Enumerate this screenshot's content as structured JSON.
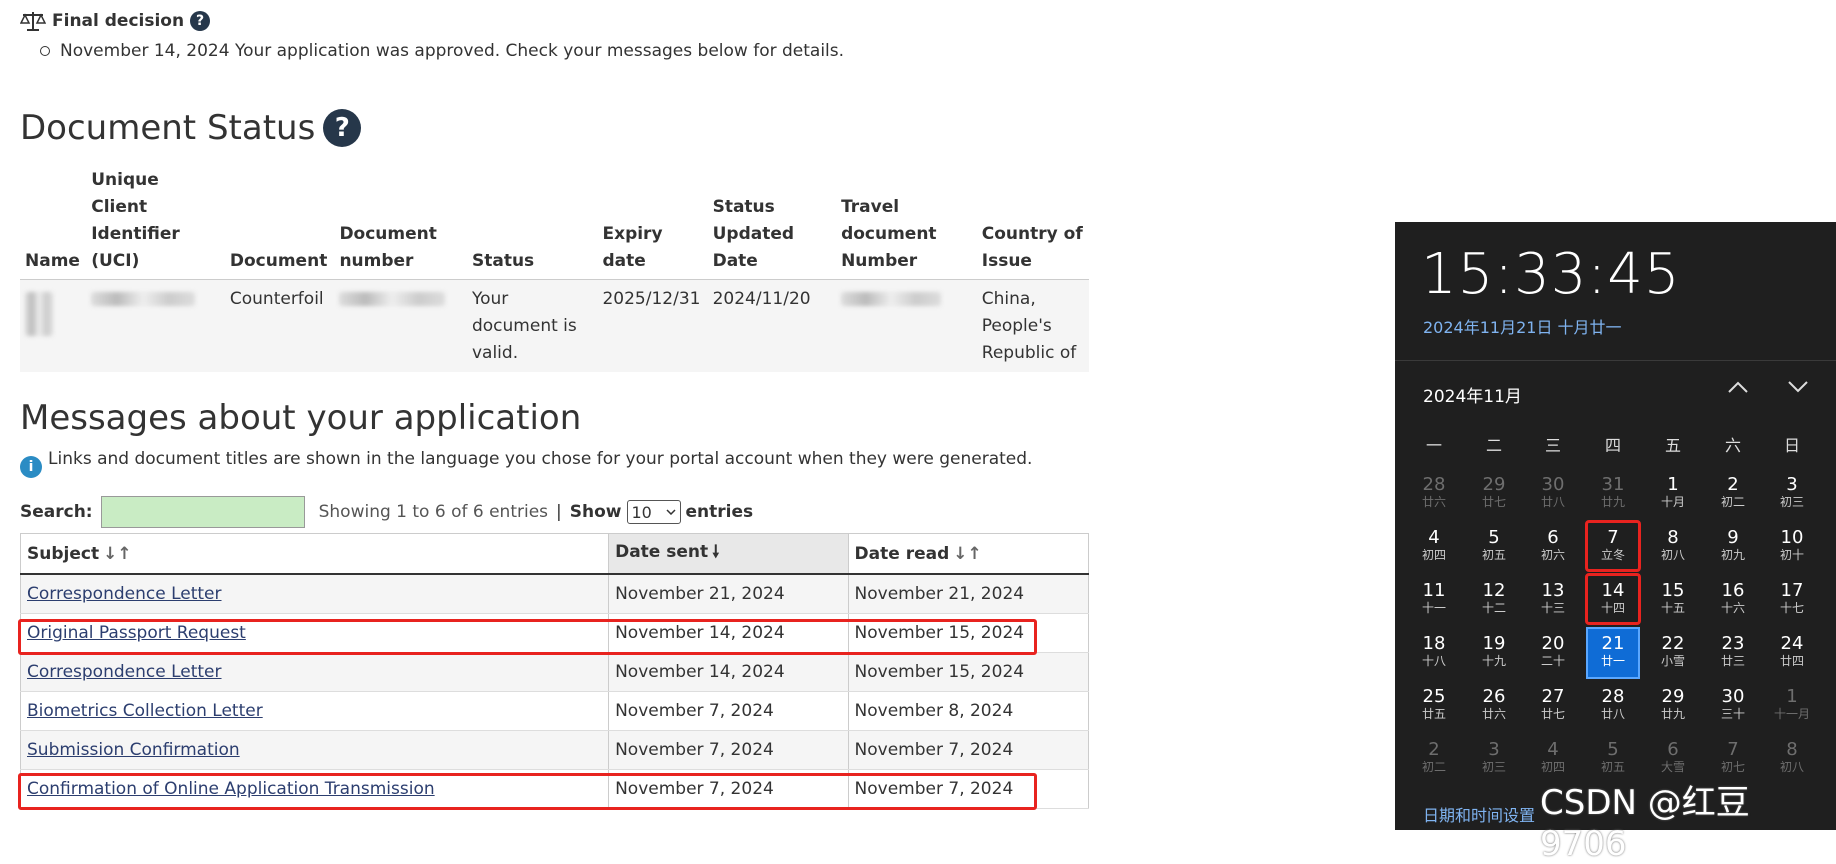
{
  "final_decision": {
    "title": "Final decision",
    "help": "?",
    "item": "November 14, 2024 Your application was approved. Check your messages below for details."
  },
  "document_status": {
    "heading": "Document Status",
    "help": "?",
    "columns": [
      "Name",
      "Unique Client Identifier (UCI)",
      "Document",
      "Document number",
      "Status",
      "Expiry date",
      "Status Updated Date",
      "Travel document Number",
      "Country of Issue"
    ],
    "row": {
      "document": "Counterfoil",
      "status": "Your document is valid.",
      "expiry": "2025/12/31",
      "updated": "2024/11/20",
      "country": "China, People's Republic of"
    }
  },
  "messages": {
    "heading": "Messages about your application",
    "info_icon": "i",
    "info": "Links and document titles are shown in the language you chose for your portal account when they were generated.",
    "search_label": "Search:",
    "search_value": "",
    "showing": "Showing 1 to 6 of 6 entries",
    "separator": "|",
    "show_label": "Show",
    "page_size": "10",
    "entries_label": "entries",
    "columns": [
      "Subject",
      "Date sent",
      "Date read"
    ],
    "rows": [
      {
        "subject": "Correspondence Letter",
        "sent": "November 21, 2024",
        "read": "November 21, 2024"
      },
      {
        "subject": "Original Passport Request",
        "sent": "November 14, 2024",
        "read": "November 15, 2024"
      },
      {
        "subject": "Correspondence Letter",
        "sent": "November 14, 2024",
        "read": "November 15, 2024"
      },
      {
        "subject": "Biometrics Collection Letter",
        "sent": "November 7, 2024",
        "read": "November 8, 2024"
      },
      {
        "subject": "Submission Confirmation",
        "sent": "November 7, 2024",
        "read": "November 7, 2024"
      },
      {
        "subject": "Confirmation of Online Application Transmission",
        "sent": "November 7, 2024",
        "read": "November 7, 2024"
      }
    ]
  },
  "clock": {
    "time": "15:33:45",
    "date": "2024年11月21日 十月廿一",
    "month": "2024年11月",
    "weekdays": [
      "一",
      "二",
      "三",
      "四",
      "五",
      "六",
      "日"
    ],
    "weeks": [
      [
        [
          "28",
          "廿六"
        ],
        [
          "29",
          "廿七"
        ],
        [
          "30",
          "廿八"
        ],
        [
          "31",
          "廿九"
        ],
        [
          "1",
          "十月"
        ],
        [
          "2",
          "初二"
        ],
        [
          "3",
          "初三"
        ]
      ],
      [
        [
          "4",
          "初四"
        ],
        [
          "5",
          "初五"
        ],
        [
          "6",
          "初六"
        ],
        [
          "7",
          "立冬"
        ],
        [
          "8",
          "初八"
        ],
        [
          "9",
          "初九"
        ],
        [
          "10",
          "初十"
        ]
      ],
      [
        [
          "11",
          "十一"
        ],
        [
          "12",
          "十二"
        ],
        [
          "13",
          "十三"
        ],
        [
          "14",
          "十四"
        ],
        [
          "15",
          "十五"
        ],
        [
          "16",
          "十六"
        ],
        [
          "17",
          "十七"
        ]
      ],
      [
        [
          "18",
          "十八"
        ],
        [
          "19",
          "十九"
        ],
        [
          "20",
          "二十"
        ],
        [
          "21",
          "廿一"
        ],
        [
          "22",
          "小雪"
        ],
        [
          "23",
          "廿三"
        ],
        [
          "24",
          "廿四"
        ]
      ],
      [
        [
          "25",
          "廿五"
        ],
        [
          "26",
          "廿六"
        ],
        [
          "27",
          "廿七"
        ],
        [
          "28",
          "廿八"
        ],
        [
          "29",
          "廿九"
        ],
        [
          "30",
          "三十"
        ],
        [
          "1",
          "十一月"
        ]
      ],
      [
        [
          "2",
          "初二"
        ],
        [
          "3",
          "初三"
        ],
        [
          "4",
          "初四"
        ],
        [
          "5",
          "初五"
        ],
        [
          "6",
          "大雪"
        ],
        [
          "7",
          "初七"
        ],
        [
          "8",
          "初八"
        ]
      ]
    ],
    "settings_link": "日期和时间设置"
  },
  "watermark": "CSDN @红豆9706"
}
